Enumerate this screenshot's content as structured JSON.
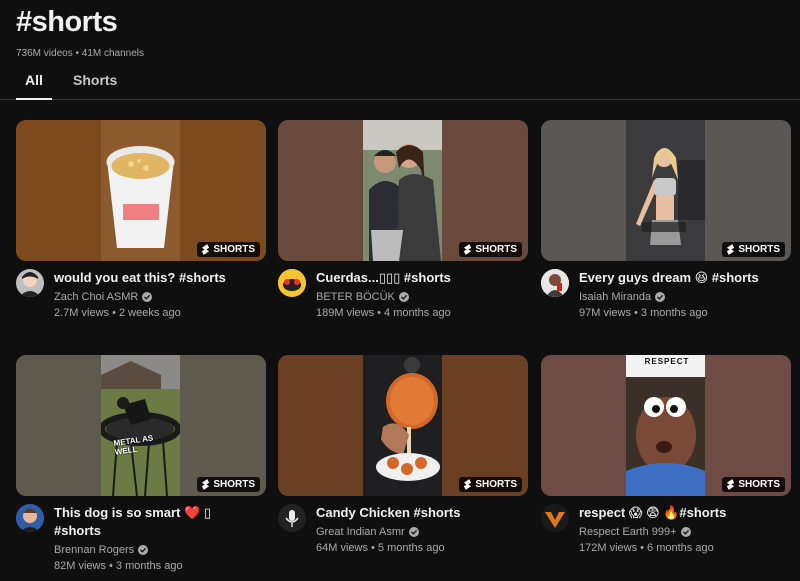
{
  "header": {
    "title": "#shorts",
    "stats": "736M videos • 41M channels"
  },
  "tabs": [
    {
      "label": "All",
      "active": true
    },
    {
      "label": "Shorts",
      "active": false
    }
  ],
  "badge_label": "SHORTS",
  "videos": [
    {
      "title": "would you eat this? #shorts",
      "title2": "",
      "channel": "Zach Choi ASMR",
      "meta": "2.7M views • 2 weeks ago",
      "thumb_bg": "#7d4a1e",
      "thumb_center": "#b9865a",
      "avatar_bg": "#3a3a3a"
    },
    {
      "title": "Cuerdas...▯▯▯ #shorts",
      "title2": "",
      "channel": "BETER BÖCÜK",
      "meta": "189M views • 4 months ago",
      "thumb_bg": "#6b4a3e",
      "thumb_center": "#8a7d66",
      "avatar_bg": "#f4c531"
    },
    {
      "title": "Every guys dream 😆 #shorts",
      "title2": "",
      "channel": "Isaiah Miranda",
      "meta": "97M views • 3 months ago",
      "thumb_bg": "#5b5754",
      "thumb_center": "#3e3e40",
      "avatar_bg": "#e6e6e6"
    },
    {
      "title": "This dog is so smart ❤️ ▯",
      "title2": "#shorts",
      "channel": "Brennan Rogers",
      "meta": "82M views • 3 months ago",
      "thumb_bg": "#5e5a4e",
      "thumb_center": "#5d6b42",
      "avatar_bg": "#2f5ea8",
      "caption": "METAL AS WELL"
    },
    {
      "title": "Candy Chicken #shorts",
      "title2": "",
      "channel": "Great Indian Asmr",
      "meta": "64M views • 5 months ago",
      "thumb_bg": "#6a3f24",
      "thumb_center": "#2a2522",
      "avatar_bg": "#222222"
    },
    {
      "title": "respect 😱 😨 🔥#shorts",
      "title2": "",
      "channel": "Respect Earth 999+",
      "meta": "172M views • 6 months ago",
      "thumb_bg": "#6e4c45",
      "thumb_center": "#2a4d8c",
      "avatar_bg": "#1a1a1a",
      "caption": "RESPECT"
    }
  ]
}
